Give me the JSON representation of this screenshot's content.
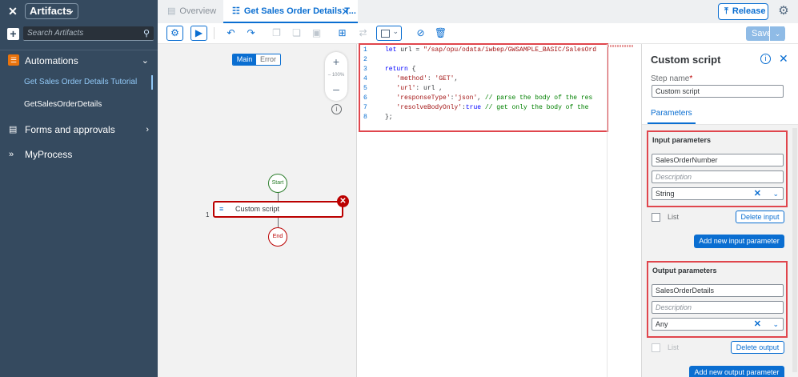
{
  "topbar": {
    "close_glyph": "✕",
    "artifacts_label": "Artifacts",
    "tabs": [
      {
        "label": "Overview",
        "icon": "document-icon"
      },
      {
        "label": "Get Sales Order Details T...",
        "icon": "process-icon"
      }
    ],
    "release_label": "Release",
    "settings_icon": "gear-icon"
  },
  "sidebar": {
    "search_placeholder": "Search Artifacts",
    "section_label": "Automations",
    "sub_items": [
      "Get Sales Order Details Tutorial",
      "GetSalesOrderDetails"
    ],
    "items": [
      {
        "label": "Forms and approvals",
        "icon": "form-icon"
      },
      {
        "label": "MyProcess",
        "icon": "process-icon"
      }
    ]
  },
  "toolbar": {
    "save_label": "Save"
  },
  "canvas": {
    "mode_on": "Main",
    "mode_off": "Error",
    "zoom_level": "100%",
    "start_label": "Start",
    "end_label": "End",
    "step_label": "Custom script",
    "step_number": "1"
  },
  "editor": {
    "lines": [
      {
        "n": "1",
        "code": "let url = \"/sap/opu/odata/iwbep/GWSAMPLE_BASIC/SalesOrd"
      },
      {
        "n": "2",
        "code": ""
      },
      {
        "n": "3",
        "code": "return {"
      },
      {
        "n": "4",
        "code": "   'method': 'GET',"
      },
      {
        "n": "5",
        "code": "   'url': url ,"
      },
      {
        "n": "6",
        "code": "   'responseType':'json', // parse the body of the res"
      },
      {
        "n": "7",
        "code": "   'resolveBodyOnly':true // get only the body of the"
      },
      {
        "n": "8",
        "code": "};"
      }
    ]
  },
  "panel": {
    "title": "Custom script",
    "step_name_label": "Step name",
    "required_mark": "*",
    "step_name_value": "Custom script",
    "tab_label": "Parameters",
    "input": {
      "title": "Input parameters",
      "name_value": "SalesOrderNumber",
      "description_placeholder": "Description",
      "type_value": "String",
      "list_label": "List",
      "delete_label": "Delete input",
      "add_label": "Add new input parameter"
    },
    "output": {
      "title": "Output parameters",
      "name_value": "SalesOrderDetails",
      "description_placeholder": "Description",
      "type_value": "Any",
      "list_label": "List",
      "delete_label": "Delete output",
      "add_label": "Add new output parameter"
    }
  },
  "colors": {
    "shell_dark": "#354a5f",
    "accent_blue": "#0a6ed1",
    "highlight_red": "#e0464d",
    "error_red": "#bb0000",
    "start_green": "#2b7d2b"
  }
}
